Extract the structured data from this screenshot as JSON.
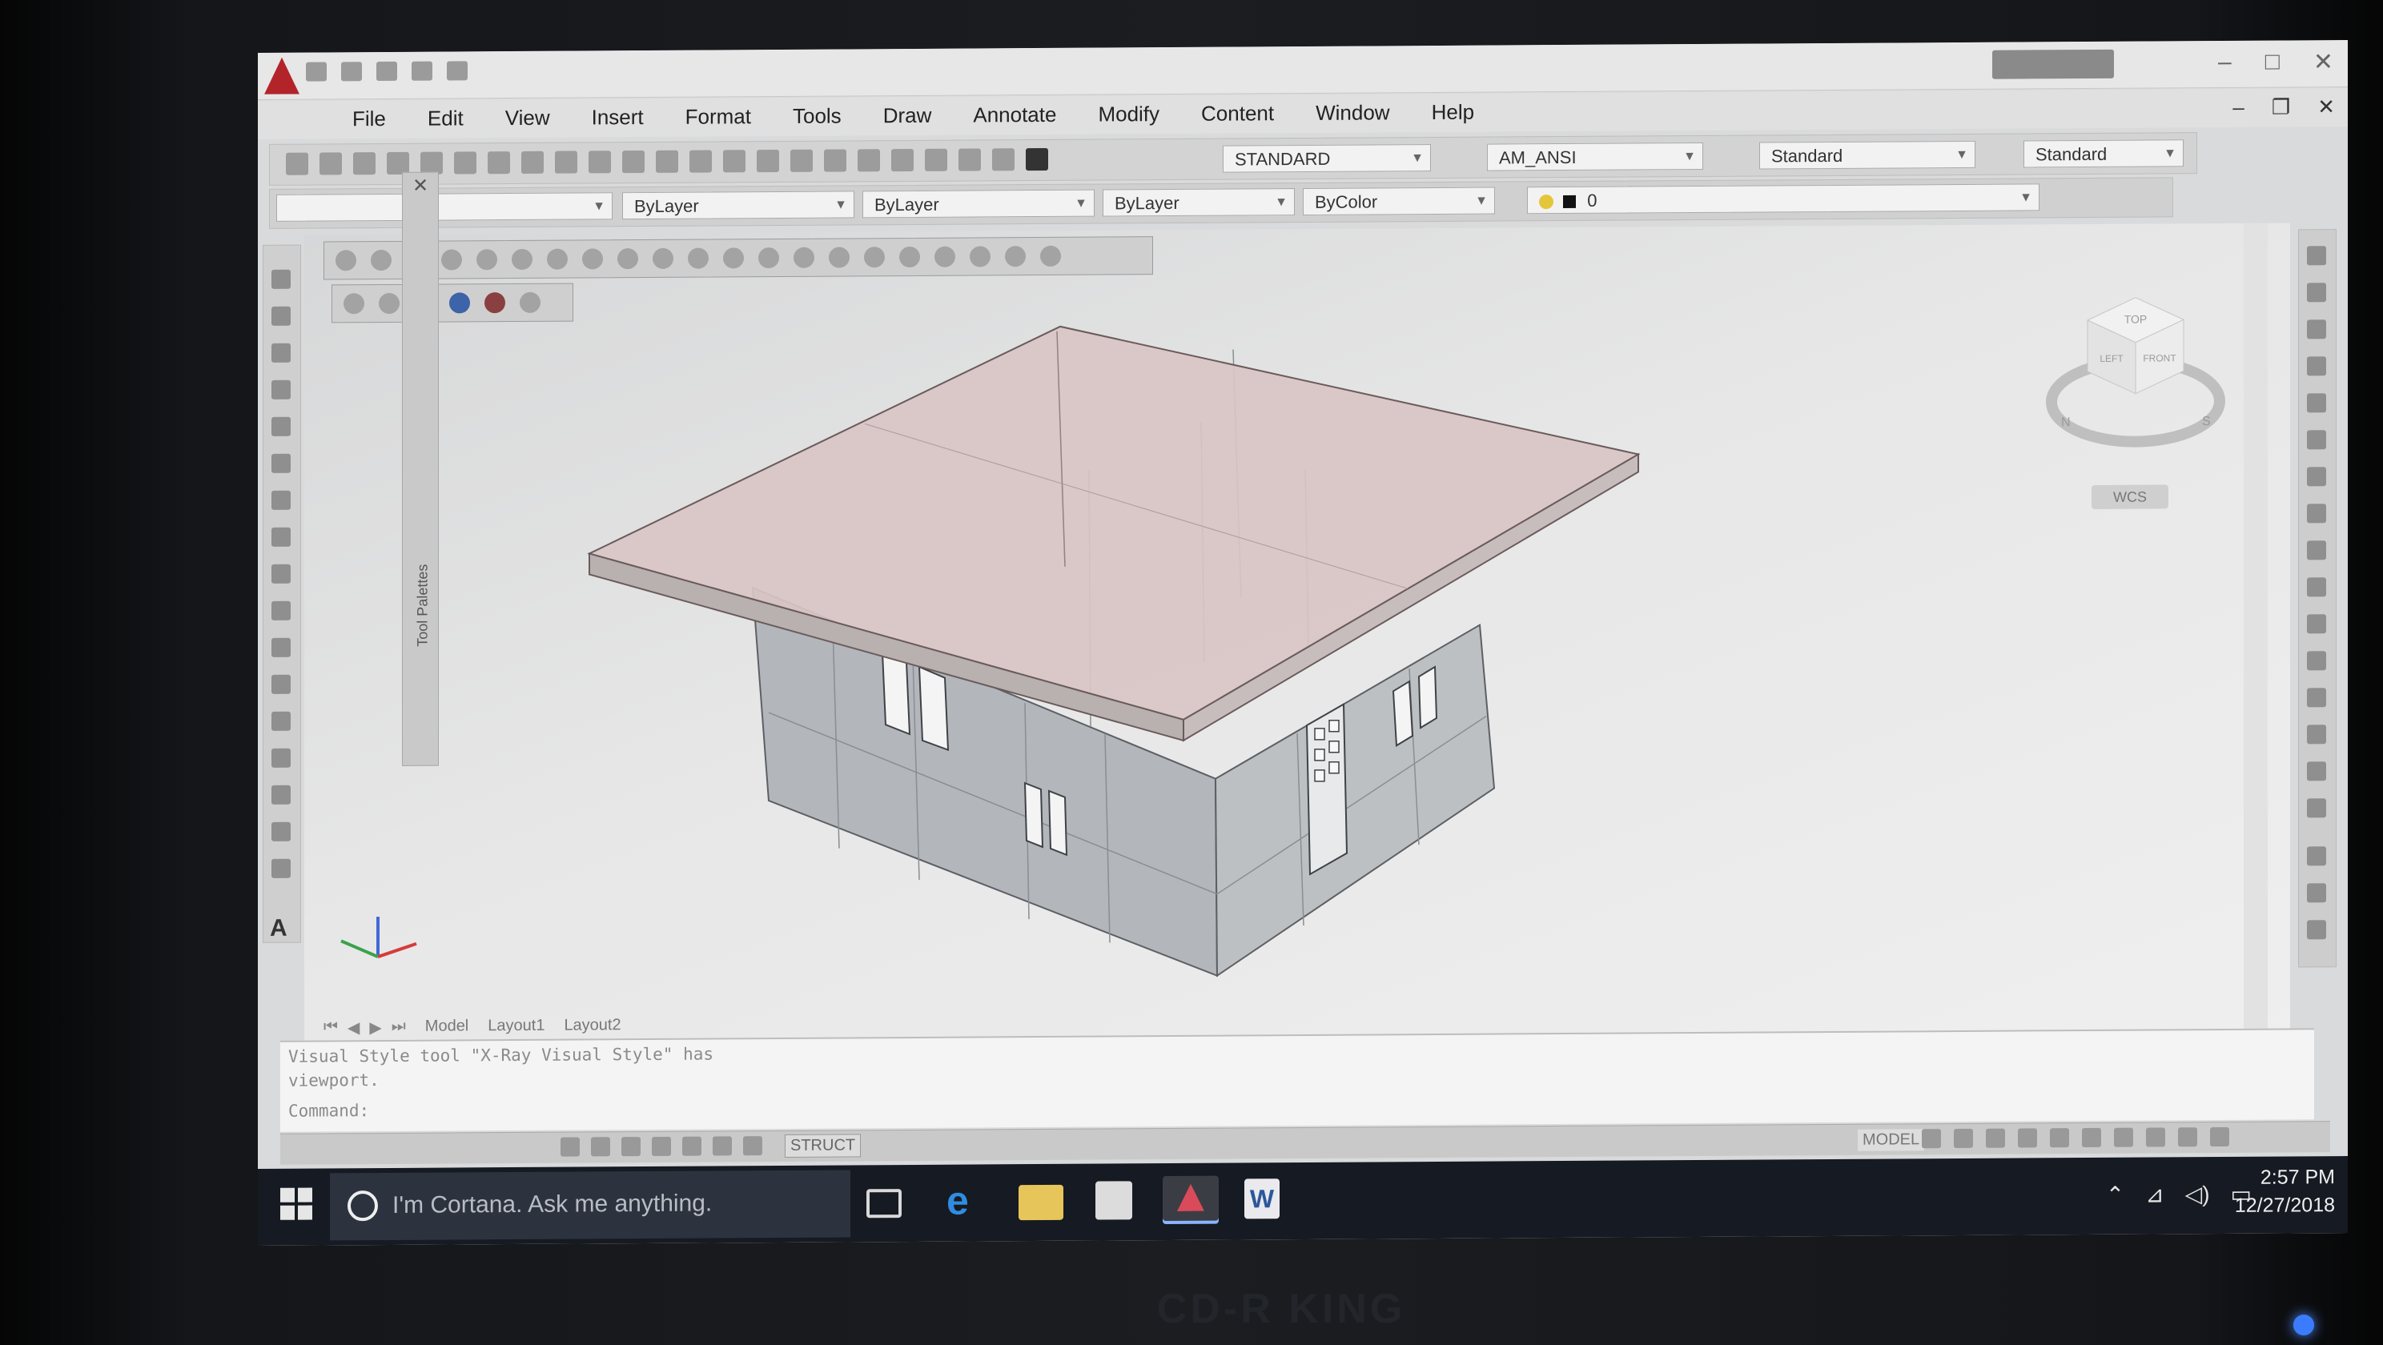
{
  "menu": [
    "File",
    "Edit",
    "View",
    "Insert",
    "Format",
    "Tools",
    "Draw",
    "Annotate",
    "Modify",
    "Content",
    "Window",
    "Help"
  ],
  "toolbar": {
    "text_style": "STANDARD",
    "dim_style": "AM_ANSI",
    "table_style": "Standard",
    "mleader_style": "Standard"
  },
  "properties": {
    "layer_combo": "ByLayer",
    "linetype_combo": "ByLayer",
    "lineweight_combo": "ByLayer",
    "color_combo": "ByColor",
    "layer_name": "0"
  },
  "palette": {
    "title": "Tool Palettes"
  },
  "viewcube": {
    "top": "TOP",
    "front": "FRONT",
    "left": "LEFT",
    "north": "N",
    "south": "S"
  },
  "viewport": {
    "wcs_label": "WCS"
  },
  "tabs": [
    "Model",
    "Layout1",
    "Layout2"
  ],
  "command_line": {
    "line1": "Visual Style tool \"X-Ray Visual Style\" has",
    "line2": "viewport.",
    "prompt": "Command:"
  },
  "status": {
    "struct": "STRUCT",
    "model": "MODEL"
  },
  "taskbar": {
    "search_placeholder": "I'm Cortana. Ask me anything.",
    "time": "2:57 PM",
    "date": "12/27/2018"
  },
  "monitor": {
    "brand": "CD-R KING"
  },
  "colors": {
    "roof": "#d8bcbc",
    "walls": "#b4b7bb",
    "app_accent": "#b3242a",
    "taskbar": "#161a22"
  }
}
